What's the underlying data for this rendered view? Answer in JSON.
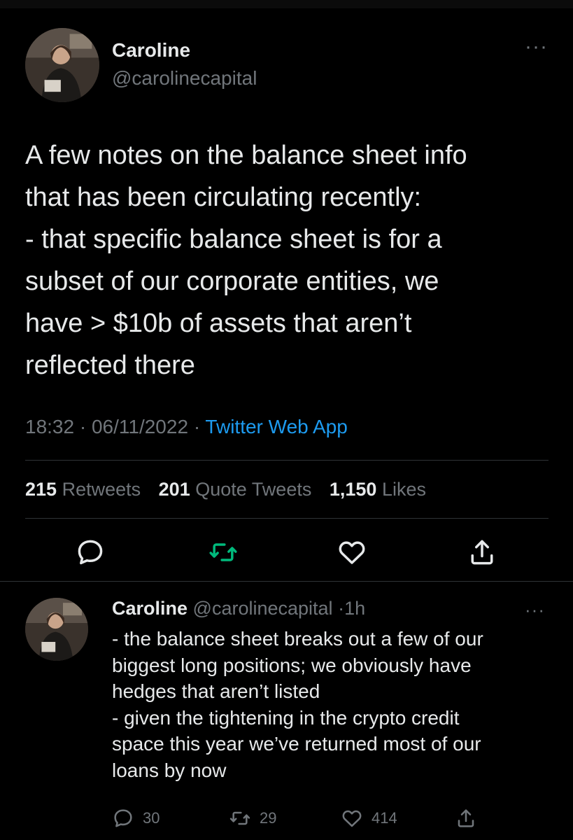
{
  "main_tweet": {
    "name": "Caroline",
    "handle": "@carolinecapital",
    "text": "A few notes on the balance sheet info\nthat has been circulating recently:\n- that specific balance sheet is for a\nsubset of our corporate entities, we\nhave > $10b of assets that aren’t\nreflected there",
    "time": "18:32",
    "separator": "·",
    "date": "06/11/2022",
    "app": "Twitter Web App",
    "stats": {
      "retweets_count": "215",
      "retweets_label": "Retweets",
      "quotes_count": "201",
      "quotes_label": "Quote Tweets",
      "likes_count": "1,150",
      "likes_label": "Likes"
    },
    "more_glyph": "···"
  },
  "reply": {
    "name": "Caroline",
    "handle": "@carolinecapital",
    "separator": "·",
    "time": "1h",
    "text": "- the balance sheet breaks out a few of our\nbiggest long positions; we obviously have\nhedges that aren’t listed\n- given the tightening in the crypto credit\nspace this year we’ve returned most of our\nloans by now",
    "replies": "30",
    "retweets": "29",
    "likes": "414",
    "more_glyph": "···"
  },
  "icons": [
    "reply-icon",
    "retweet-icon",
    "like-icon",
    "share-icon",
    "more-icon"
  ],
  "colors": {
    "background": "#000000",
    "text": "#e7e9ea",
    "muted": "#71767b",
    "link": "#1d9bf0",
    "retweet_green": "#00ba7c",
    "divider": "#2f3336"
  }
}
